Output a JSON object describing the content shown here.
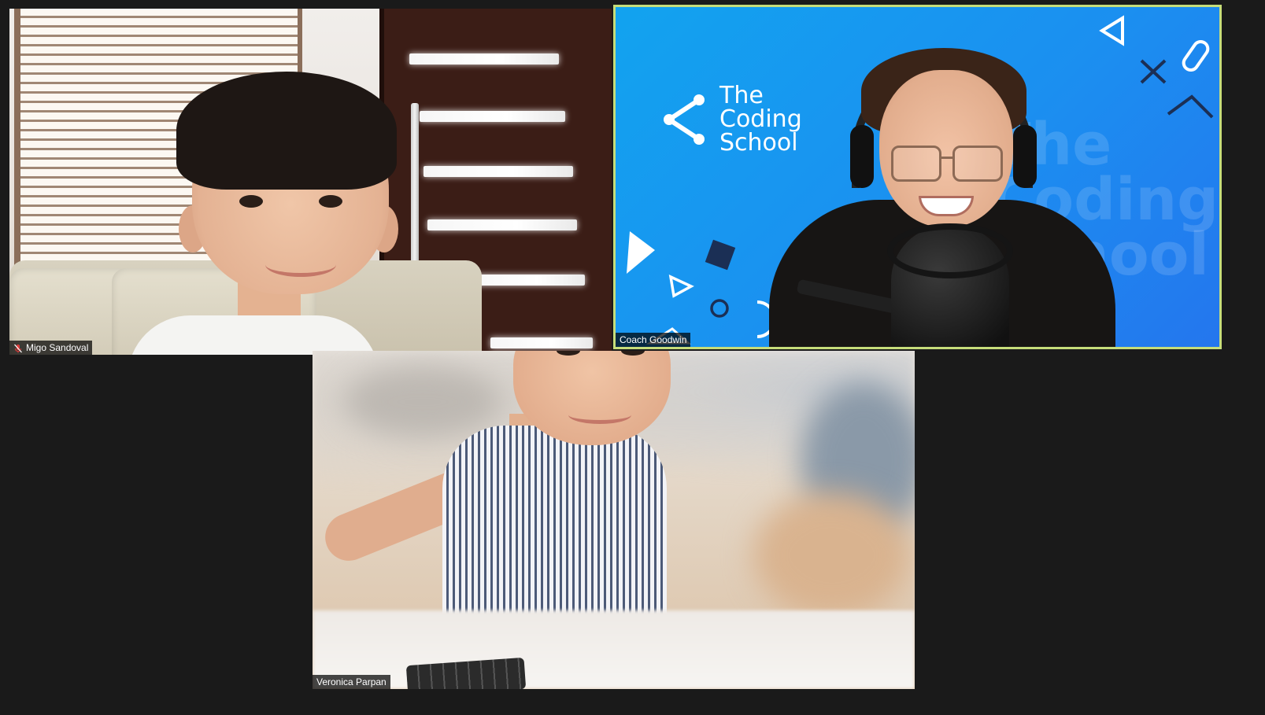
{
  "app": "Zoom gallery view",
  "participants": [
    {
      "name": "Migo Sandoval",
      "muted": true,
      "active_speaker": false
    },
    {
      "name": "Coach Goodwin",
      "muted": false,
      "active_speaker": true
    },
    {
      "name": "Veronica Parpan",
      "muted": false,
      "active_speaker": false
    }
  ],
  "virtual_background": {
    "logo_line1": "The",
    "logo_line2": "Coding",
    "logo_line3": "School",
    "watermark": "The Coding School"
  },
  "colors": {
    "active_speaker_border": "#c6dd7a",
    "window_background": "#1a1a1a",
    "brand_blue": "#1b8ff0",
    "mute_icon": "#e03a3a"
  },
  "icons": {
    "mute": "mic-off-icon",
    "logo_mark": "share-nodes-icon"
  }
}
